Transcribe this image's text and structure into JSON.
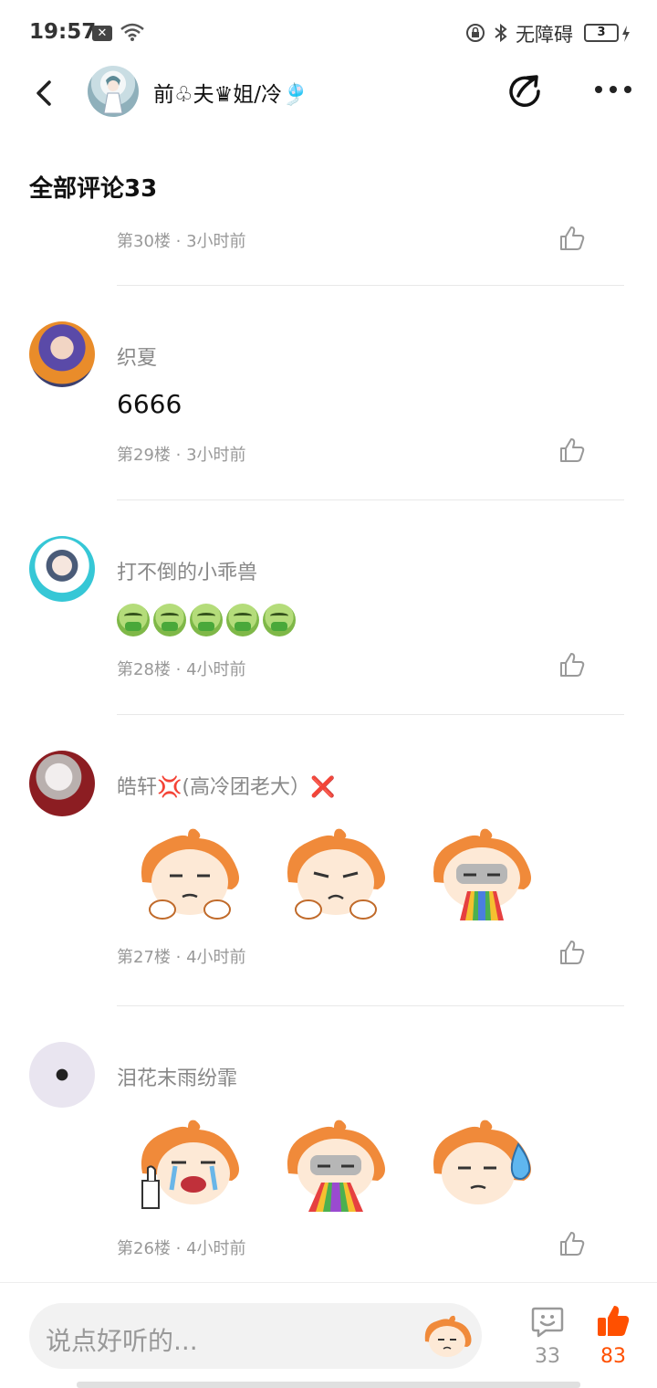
{
  "status_bar": {
    "time": "19:57",
    "accessibility_label": "无障碍",
    "battery": "3"
  },
  "header": {
    "title": "前♧夫♛姐/冷🎐",
    "back_icon": "chevron-left-icon",
    "share_icon": "share-icon",
    "more_icon": "more-icon"
  },
  "section": {
    "title": "全部评论33"
  },
  "previous_comment": {
    "meta": "第30楼 · 3小时前"
  },
  "comments": [
    {
      "name": "织夏",
      "text": "6666",
      "meta": "第29楼 · 3小时前"
    },
    {
      "name": "打不倒的小乖兽",
      "emoji": "🤮🤮🤮🤮🤮",
      "meta": "第28楼 · 4小时前"
    },
    {
      "name": "皓轩💢(高冷团老大）❌",
      "stickers": [
        "unimpressed-sticker",
        "pouting-sticker",
        "rainbow-vomit-sticker"
      ],
      "meta": "第27楼 · 4小时前"
    },
    {
      "name": "泪花末雨纷霏",
      "stickers": [
        "crying-thumbs-up-sticker",
        "rainbow-vomit-sticker",
        "sweat-drop-sticker"
      ],
      "meta": "第26楼 · 4小时前"
    }
  ],
  "bottom_bar": {
    "placeholder": "说点好听的...",
    "comment_count": "33",
    "like_count": "83"
  },
  "colors": {
    "accent": "#ff5000",
    "text_secondary": "#999999",
    "divider": "#e8e8e8",
    "sticker_orange": "#f08a3a"
  }
}
